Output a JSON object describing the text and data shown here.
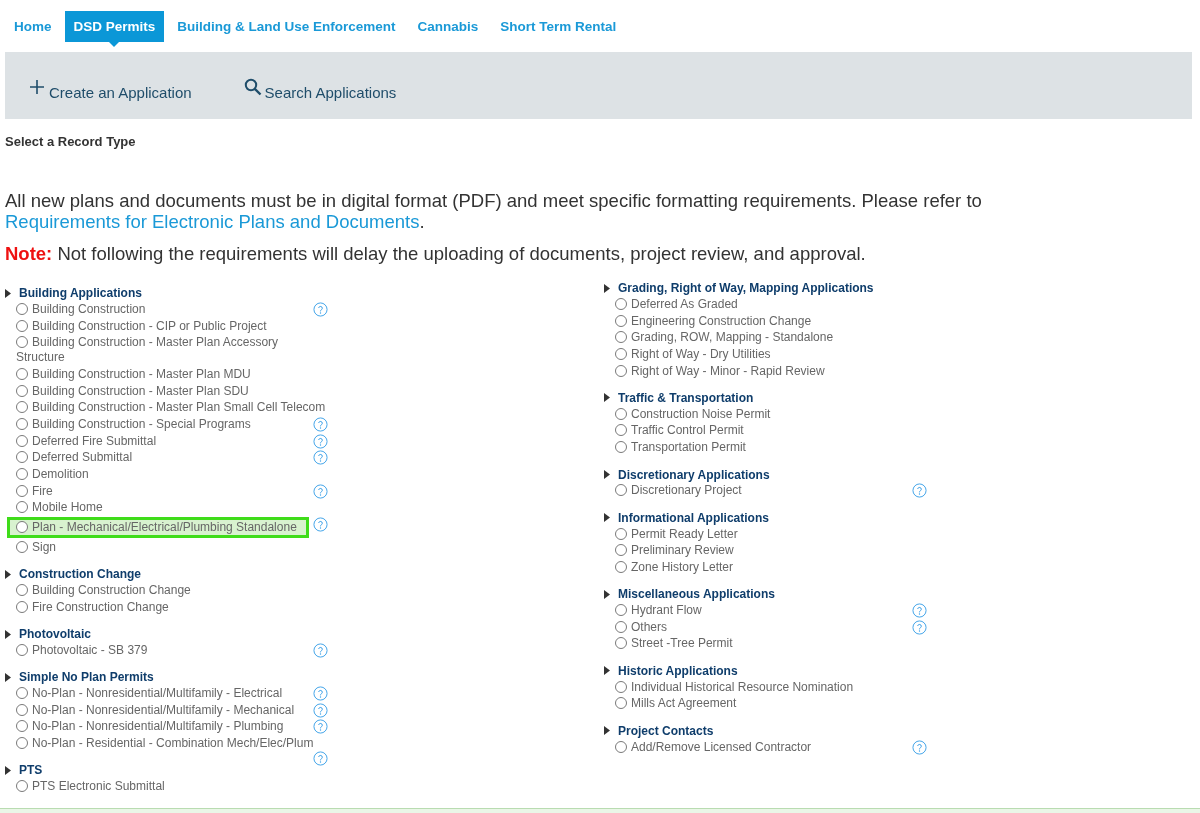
{
  "nav_tabs": [
    {
      "label": "Home",
      "selected": false
    },
    {
      "label": "DSD Permits",
      "selected": true
    },
    {
      "label": "Building & Land Use Enforcement",
      "selected": false
    },
    {
      "label": "Cannabis",
      "selected": false
    },
    {
      "label": "Short Term Rental",
      "selected": false
    }
  ],
  "toolbar": {
    "buttons": [
      {
        "label": "Create an Application",
        "kind": "create"
      },
      {
        "label": "Search Applications",
        "kind": "search"
      }
    ]
  },
  "section_title": "Select a Record Type",
  "notice": {
    "text": "All new plans and documents must be in digital format (PDF) and meet specific formatting requirements. Please refer to",
    "link": "Requirements for Electronic Plans and Documents",
    "after_link": "."
  },
  "note": {
    "label": "Note:",
    "text": "Not following the requirements will delay the uploading of documents, project review, and approval."
  },
  "columns": [
    {
      "groups": [
        {
          "title": "Building Applications",
          "items": [
            {
              "label": "Building Construction",
              "selected": false,
              "help_icon": true,
              "highlighted": false
            },
            {
              "label": "Building Construction - CIP or Public Project",
              "selected": false,
              "help_icon": false,
              "highlighted": false
            },
            {
              "label": "Building Construction - Master Plan Accessory Structure",
              "selected": false,
              "help_icon": false,
              "highlighted": false
            },
            {
              "label": "Building Construction - Master Plan MDU",
              "selected": false,
              "help_icon": false,
              "highlighted": false
            },
            {
              "label": "Building Construction - Master Plan SDU",
              "selected": false,
              "help_icon": false,
              "highlighted": false
            },
            {
              "label": "Building Construction - Master Plan Small Cell Telecom",
              "selected": false,
              "help_icon": false,
              "highlighted": false
            },
            {
              "label": "Building Construction - Special Programs",
              "selected": false,
              "help_icon": true,
              "highlighted": false
            },
            {
              "label": "Deferred Fire Submittal",
              "selected": false,
              "help_icon": true,
              "highlighted": false
            },
            {
              "label": "Deferred Submittal",
              "selected": false,
              "help_icon": true,
              "highlighted": false
            },
            {
              "label": "Demolition",
              "selected": false,
              "help_icon": false,
              "highlighted": false
            },
            {
              "label": "Fire",
              "selected": false,
              "help_icon": true,
              "highlighted": false
            },
            {
              "label": "Mobile Home",
              "selected": false,
              "help_icon": false,
              "highlighted": false
            },
            {
              "label": "Plan - Mechanical/Electrical/Plumbing Standalone",
              "selected": false,
              "help_icon": true,
              "highlighted": true
            },
            {
              "label": "Sign",
              "selected": false,
              "help_icon": false,
              "highlighted": false
            }
          ]
        },
        {
          "title": "Construction Change",
          "items": [
            {
              "label": "Building Construction Change",
              "selected": false,
              "help_icon": false,
              "highlighted": false
            },
            {
              "label": "Fire Construction Change",
              "selected": false,
              "help_icon": false,
              "highlighted": false
            }
          ]
        },
        {
          "title": "Photovoltaic",
          "items": [
            {
              "label": "Photovoltaic - SB 379",
              "selected": false,
              "help_icon": true,
              "highlighted": false
            }
          ]
        },
        {
          "title": "Simple No Plan Permits",
          "items": [
            {
              "label": "No-Plan - Nonresidential/Multifamily - Electrical",
              "selected": false,
              "help_icon": true,
              "highlighted": false
            },
            {
              "label": "No-Plan - Nonresidential/Multifamily - Mechanical",
              "selected": false,
              "help_icon": true,
              "highlighted": false
            },
            {
              "label": "No-Plan - Nonresidential/Multifamily - Plumbing",
              "selected": false,
              "help_icon": true,
              "highlighted": false
            },
            {
              "label": "No-Plan - Residential - Combination Mech/Elec/Plum",
              "selected": false,
              "help_icon": true,
              "highlighted": false
            }
          ]
        },
        {
          "title": "PTS",
          "items": [
            {
              "label": "PTS Electronic Submittal",
              "selected": false,
              "help_icon": false,
              "highlighted": false
            }
          ]
        }
      ]
    },
    {
      "groups": [
        {
          "title": "Grading, Right of Way, Mapping Applications",
          "items": [
            {
              "label": "Deferred As Graded",
              "selected": false,
              "help_icon": false,
              "highlighted": false
            },
            {
              "label": "Engineering Construction Change",
              "selected": false,
              "help_icon": false,
              "highlighted": false
            },
            {
              "label": "Grading, ROW, Mapping - Standalone",
              "selected": false,
              "help_icon": false,
              "highlighted": false
            },
            {
              "label": "Right of Way - Dry Utilities",
              "selected": false,
              "help_icon": false,
              "highlighted": false
            },
            {
              "label": "Right of Way - Minor - Rapid Review",
              "selected": false,
              "help_icon": false,
              "highlighted": false
            }
          ]
        },
        {
          "title": "Traffic & Transportation",
          "items": [
            {
              "label": "Construction Noise Permit",
              "selected": false,
              "help_icon": false,
              "highlighted": false
            },
            {
              "label": "Traffic Control Permit",
              "selected": false,
              "help_icon": false,
              "highlighted": false
            },
            {
              "label": "Transportation Permit",
              "selected": false,
              "help_icon": false,
              "highlighted": false
            }
          ]
        },
        {
          "title": "Discretionary Applications",
          "items": [
            {
              "label": "Discretionary Project",
              "selected": false,
              "help_icon": true,
              "highlighted": false
            }
          ]
        },
        {
          "title": "Informational Applications",
          "items": [
            {
              "label": "Permit Ready Letter",
              "selected": false,
              "help_icon": false,
              "highlighted": false
            },
            {
              "label": "Preliminary Review",
              "selected": false,
              "help_icon": false,
              "highlighted": false
            },
            {
              "label": "Zone History Letter",
              "selected": false,
              "help_icon": false,
              "highlighted": false
            }
          ]
        },
        {
          "title": "Miscellaneous Applications",
          "items": [
            {
              "label": "Hydrant Flow",
              "selected": false,
              "help_icon": true,
              "highlighted": false
            },
            {
              "label": "Others",
              "selected": false,
              "help_icon": true,
              "highlighted": false
            },
            {
              "label": "Street -Tree Permit",
              "selected": false,
              "help_icon": false,
              "highlighted": false
            }
          ]
        },
        {
          "title": "Historic Applications",
          "items": [
            {
              "label": "Individual Historical Resource Nomination",
              "selected": false,
              "help_icon": false,
              "highlighted": false
            },
            {
              "label": "Mills Act Agreement",
              "selected": false,
              "help_icon": false,
              "highlighted": false
            }
          ]
        },
        {
          "title": "Project Contacts",
          "items": [
            {
              "label": "Add/Remove Licensed Contractor",
              "selected": false,
              "help_icon": true,
              "highlighted": false
            }
          ]
        }
      ]
    }
  ]
}
